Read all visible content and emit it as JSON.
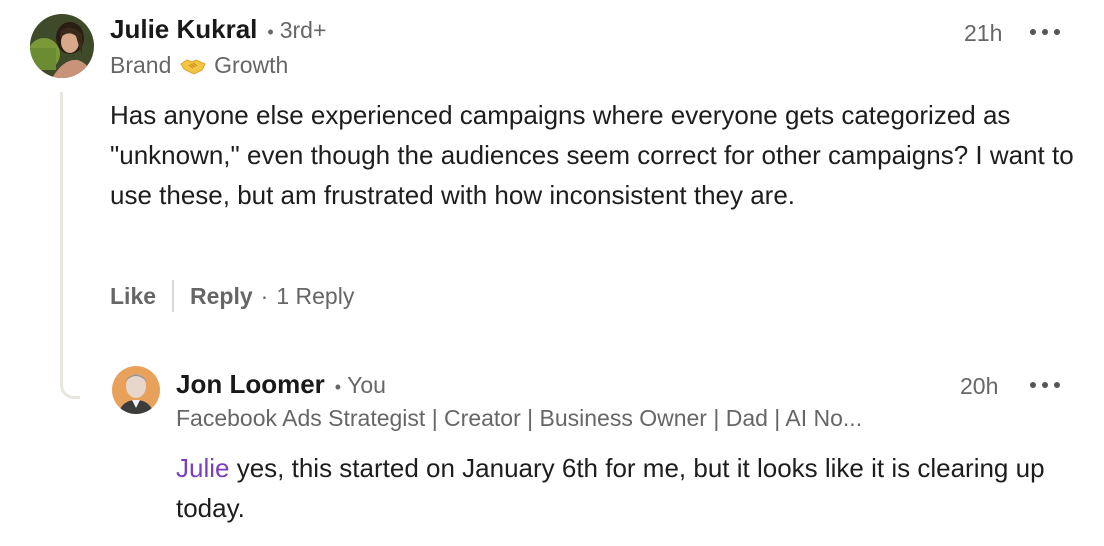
{
  "comment": {
    "author": "Julie Kukral",
    "degree": "3rd+",
    "headline_before": "Brand",
    "headline_icon": "handshake-emoji",
    "headline_after": "Growth",
    "time": "21h",
    "text": "Has anyone else experienced campaigns where everyone gets categorized as \"unknown,\" even though the audiences seem correct for other campaigns? I want to use these, but am frustrated with how inconsistent they are.",
    "actions": {
      "like": "Like",
      "reply": "Reply",
      "reply_count": "1 Reply"
    }
  },
  "reply": {
    "author": "Jon Loomer",
    "degree": "You",
    "headline": "Facebook Ads Strategist | Creator | Business Owner | Dad | AI No...",
    "time": "20h",
    "mention": "Julie",
    "text": " yes, this started on January 6th for me, but it looks like it is clearing up today."
  },
  "colors": {
    "mention": "#7a3fbf",
    "muted": "#666666",
    "thread_line": "#e9e5df"
  }
}
